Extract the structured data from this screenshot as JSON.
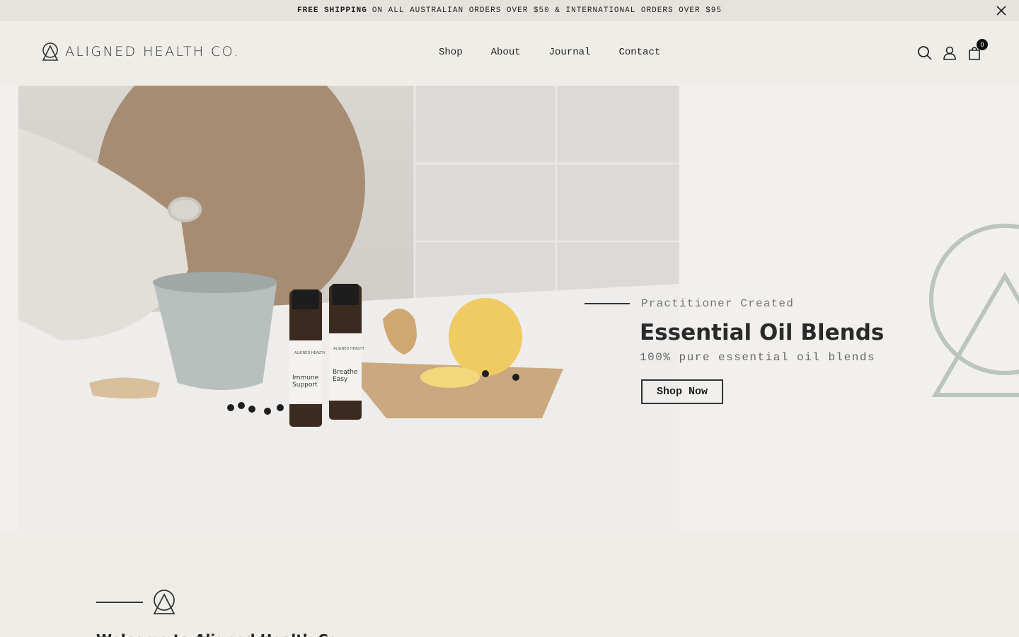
{
  "announcement": {
    "bold": "FREE SHIPPING",
    "text": "ON ALL AUSTRALIAN ORDERS OVER $50 & INTERNATIONAL ORDERS OVER $95",
    "close_icon": "close-icon"
  },
  "header": {
    "logo_text": "ALIGNED HEALTH CO.",
    "nav": [
      "Shop",
      "About",
      "Journal",
      "Contact"
    ],
    "icons": [
      "search-icon",
      "account-icon",
      "cart-icon"
    ],
    "cart_count": "0"
  },
  "hero": {
    "eyebrow": "Practitioner Created",
    "title": "Essential Oil Blends",
    "subtitle": "100% pure essential oil blends",
    "button": "Shop Now",
    "bottle_labels": [
      {
        "brand": "ALIGNED HEALTH",
        "name": "Immune Support"
      },
      {
        "brand": "ALIGNED HEALTH",
        "name": "Breathe Easy"
      }
    ]
  },
  "welcome": {
    "title": "Welcome to Aligned Health Co."
  },
  "colors": {
    "background": "#efede8",
    "announcement_bg": "#e6e3de",
    "brand_mark": "#b9c5bd",
    "text": "#1f1f1f"
  }
}
